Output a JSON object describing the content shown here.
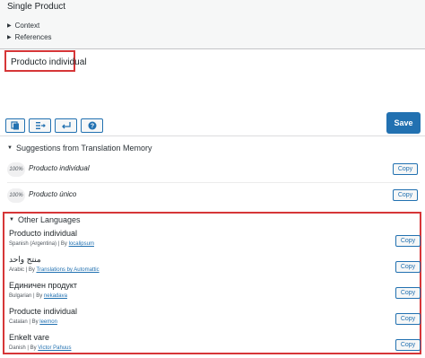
{
  "original": {
    "text": "Single Product",
    "context_label": "Context",
    "references_label": "References"
  },
  "editor": {
    "translation": "Producto individual",
    "save_label": "Save",
    "tools": [
      "copy-original-icon",
      "insert-tab-icon",
      "insert-newline-icon",
      "help-icon"
    ]
  },
  "suggestions": {
    "title": "Suggestions from Translation Memory",
    "items": [
      {
        "score": "100%",
        "text": "Producto individual",
        "copy_label": "Copy"
      },
      {
        "score": "100%",
        "text": "Producto único",
        "copy_label": "Copy"
      }
    ]
  },
  "other_languages": {
    "title": "Other Languages",
    "items": [
      {
        "text": "Producto individual",
        "language": "Spanish (Argentina) | By",
        "author": "localipsum",
        "copy_label": "Copy"
      },
      {
        "text": "منتج واحد",
        "language": "Arabic | By",
        "author": "Translations by Automattic",
        "copy_label": "Copy"
      },
      {
        "text": "Единичен продукт",
        "language": "Bulgarian | By",
        "author": "nekadava",
        "copy_label": "Copy"
      },
      {
        "text": "Producte individual",
        "language": "Catalan | By",
        "author": "leemon",
        "copy_label": "Copy"
      },
      {
        "text": "Enkelt vare",
        "language": "Danish | By",
        "author": "Victor Pahuus",
        "copy_label": "Copy"
      }
    ]
  },
  "colors": {
    "accent": "#2271b1",
    "highlight": "#d63638"
  }
}
